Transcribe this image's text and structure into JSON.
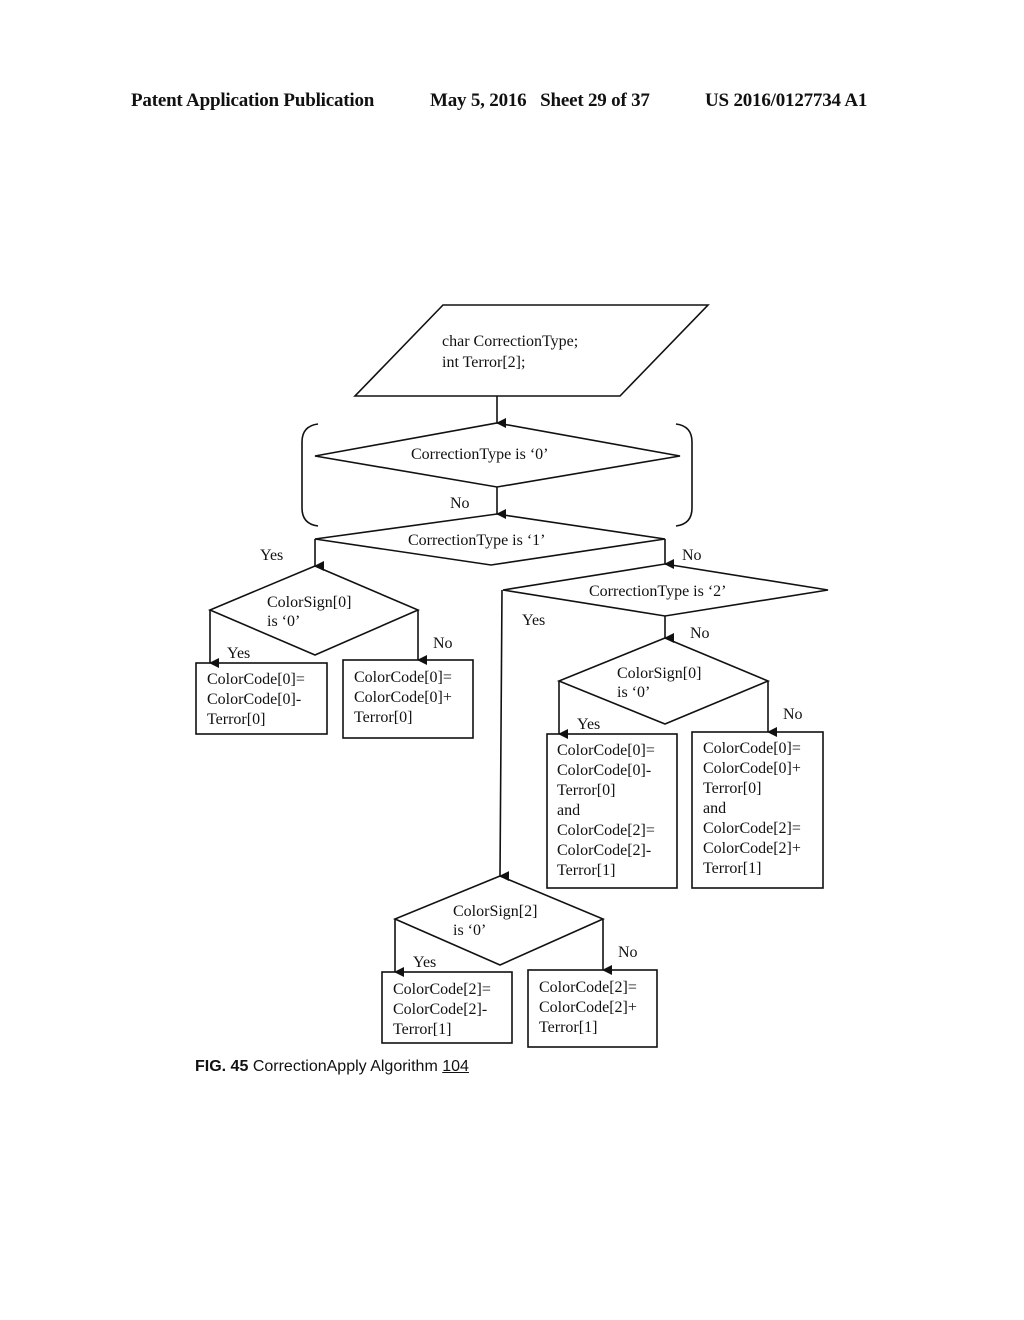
{
  "header": {
    "left": "Patent Application Publication",
    "date_sheet": "May 5, 2016   Sheet 29 of 37",
    "number": "US 2016/0127734 A1"
  },
  "diagram": {
    "input": {
      "line1": "char CorrectionType;",
      "line2": "int Terror[2];"
    },
    "decision_type0": "CorrectionType is ‘0’",
    "decision_type1": "CorrectionType is ‘1’",
    "decision_type2": "CorrectionType is ‘2’",
    "colorsign0_left": {
      "line1": "ColorSign[0]",
      "line2": "is ‘0’"
    },
    "colorsign0_right": {
      "line1": "ColorSign[0]",
      "line2": "is ‘0’"
    },
    "colorsign2": {
      "line1": "ColorSign[2]",
      "line2": "is ‘0’"
    },
    "labels": {
      "no_type0": "No",
      "yes_type1": "Yes",
      "no_type1": "No",
      "yes_type2": "Yes",
      "no_type2": "No",
      "yes_cs0_left": "Yes",
      "no_cs0_left": "No",
      "yes_cs0_right": "Yes",
      "no_cs0_right": "No",
      "yes_cs2": "Yes",
      "no_cs2": "No"
    },
    "box_cs0_left_yes": [
      "ColorCode[0]=",
      "ColorCode[0]-",
      "Terror[0]"
    ],
    "box_cs0_left_no": [
      "ColorCode[0]=",
      "ColorCode[0]+",
      "Terror[0]"
    ],
    "box_cs0_right_yes": [
      "ColorCode[0]=",
      "ColorCode[0]-",
      "Terror[0]",
      "and",
      "ColorCode[2]=",
      "ColorCode[2]-",
      "Terror[1]"
    ],
    "box_cs0_right_no": [
      "ColorCode[0]=",
      "ColorCode[0]+",
      "Terror[0]",
      "and",
      "ColorCode[2]=",
      "ColorCode[2]+",
      "Terror[1]"
    ],
    "box_cs2_yes": [
      "ColorCode[2]=",
      "ColorCode[2]-",
      "Terror[1]"
    ],
    "box_cs2_no": [
      "ColorCode[2]=",
      "ColorCode[2]+",
      "Terror[1]"
    ]
  },
  "caption": {
    "fig": "FIG. 45",
    "title": "CorrectionApply Algorithm",
    "ref": "104"
  }
}
